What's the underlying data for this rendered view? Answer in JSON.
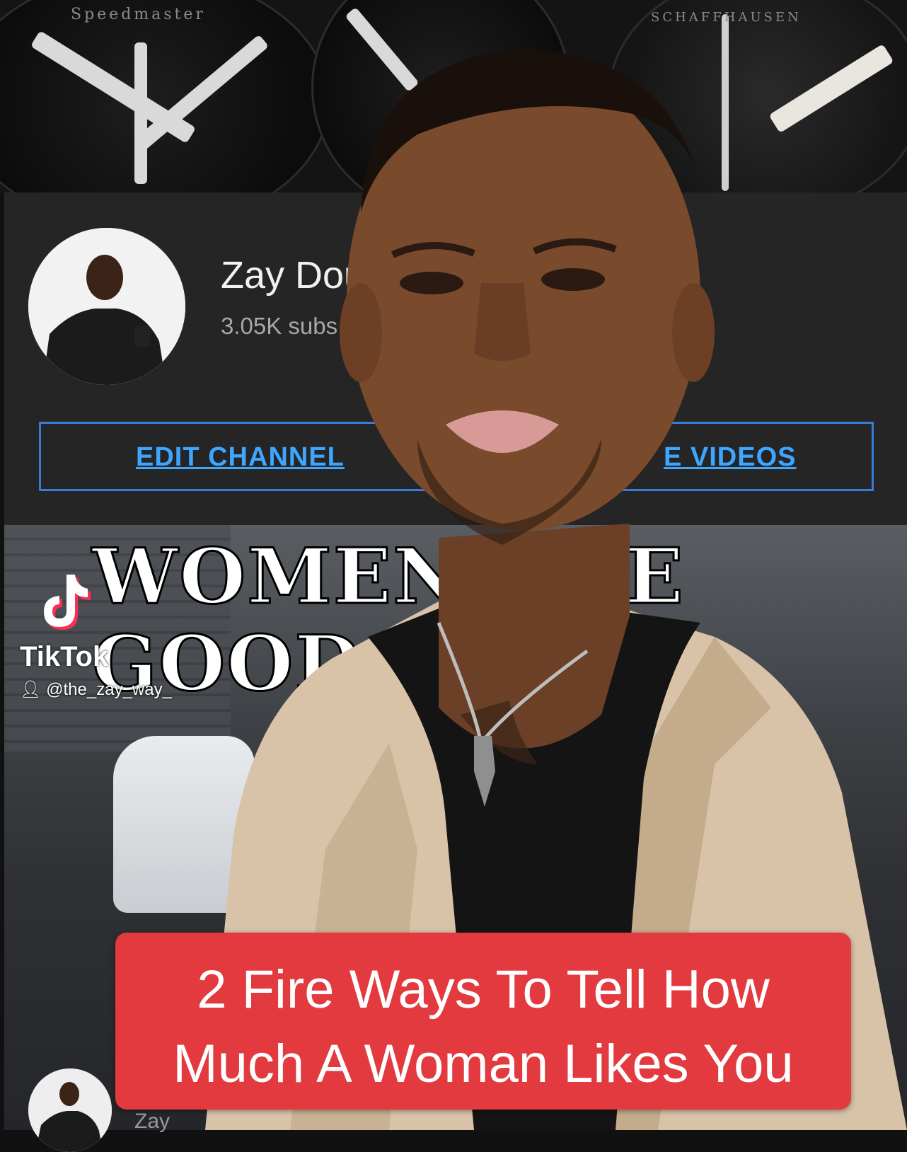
{
  "background": {
    "watch_brand_left": "Speedmaster",
    "watch_brand_right": "SCHAFFHAUSEN"
  },
  "channel": {
    "name": "Zay Dou",
    "subscribers": "3.05K subs",
    "edit_button_label": "EDIT CHANNEL",
    "videos_button_label": "E VIDEOS",
    "bottom_name": "Zay"
  },
  "headline": {
    "line1": "WOMEN I      KE",
    "line2": "GOOD M"
  },
  "watermark": {
    "brand": "TikTok",
    "username": "@the_zay_way_"
  },
  "caption": {
    "line1": "2 Fire Ways To Tell How",
    "line2": "Much A Woman Likes You"
  },
  "colors": {
    "caption_bg": "#e23a3e",
    "link_blue": "#3ea6ff",
    "panel_bg": "#252525"
  }
}
